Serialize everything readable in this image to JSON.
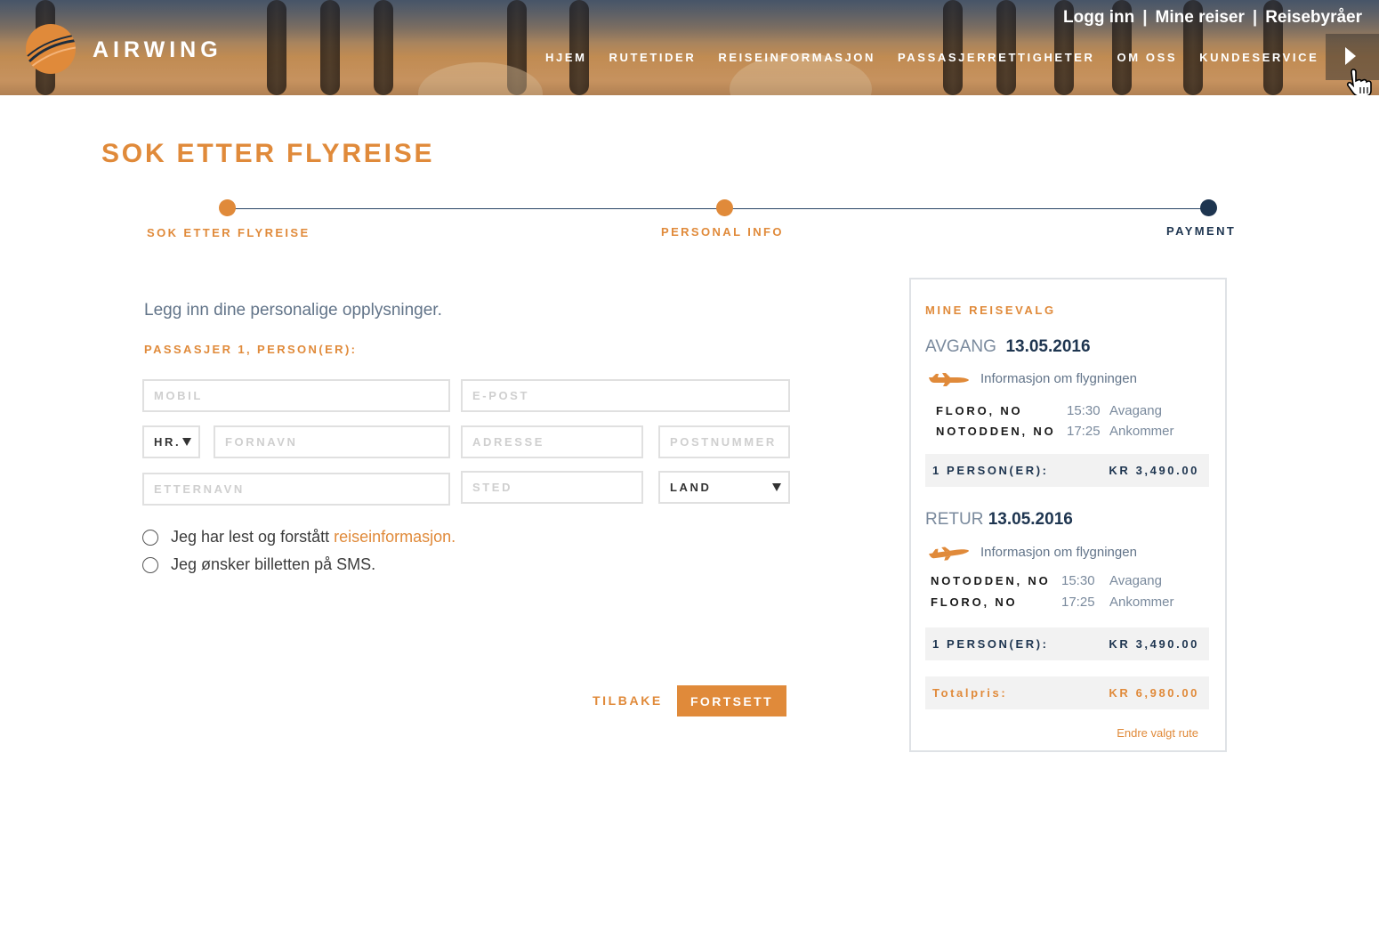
{
  "header": {
    "brand": "AIRWING",
    "top_links": [
      "Logg inn",
      "Mine reiser",
      "Reisebyråer"
    ],
    "separator": "|",
    "nav": [
      "HJEM",
      "RUTETIDER",
      "REISEINFORMASJON",
      "PASSASJERRETTIGHETER",
      "OM OSS",
      "KUNDESERVICE"
    ]
  },
  "page_title": "SOK ETTER FLYREISE",
  "progress": {
    "steps": [
      {
        "label": "SOK ETTER FLYREISE",
        "state": "done"
      },
      {
        "label": "PERSONAL INFO",
        "state": "done"
      },
      {
        "label": "PAYMENT",
        "state": "current"
      }
    ]
  },
  "form": {
    "intro": "Legg inn dine personalige opplysninger.",
    "passenger_label": "PASSASJER 1, PERSON(ER):",
    "fields": {
      "mobil": "MOBIL",
      "epost": "E-POST",
      "title_select": "HR.",
      "fornavn": "FORNAVN",
      "adresse": "ADRESSE",
      "postnummer": "POSTNUMMER",
      "etternavn": "ETTERNAVN",
      "sted": "STED",
      "land_select": "LAND"
    },
    "check1_text": "Jeg har lest og forstått ",
    "check1_link": "reiseinformasjon.",
    "check2_text": "Jeg ønsker billetten på SMS.",
    "back_label": "TILBAKE",
    "next_label": "FORTSETT"
  },
  "summary": {
    "heading": "MINE REISEVALG",
    "outbound": {
      "label": "AVGANG",
      "date": "13.05.2016",
      "info": "Informasjon om flygningen",
      "from_city": "FLORO, NO",
      "from_time": "15:30",
      "from_action": "Avagang",
      "to_city": "NOTODDEN, NO",
      "to_time": "17:25",
      "to_action": "Ankommer",
      "persons": "1 PERSON(ER):",
      "price": "KR 3,490.00"
    },
    "return": {
      "label": "RETUR",
      "date": "13.05.2016",
      "info": "Informasjon om flygningen",
      "from_city": "NOTODDEN, NO",
      "from_time": "15:30",
      "from_action": "Avagang",
      "to_city": "FLORO, NO",
      "to_time": "17:25",
      "to_action": "Ankommer",
      "persons": "1 PERSON(ER):",
      "price": "KR 3,490.00"
    },
    "total_label": "Totalpris:",
    "total_price": "KR 6,980.00",
    "change_route": "Endre valgt rute"
  },
  "colors": {
    "accent": "#e08a3a",
    "navy": "#1e3550",
    "muted": "#627489"
  },
  "icons": [
    "airplane-icon",
    "radio-icon",
    "dropdown-arrow-icon",
    "play-arrow-icon",
    "hand-cursor-icon",
    "logo-swoosh-icon"
  ]
}
